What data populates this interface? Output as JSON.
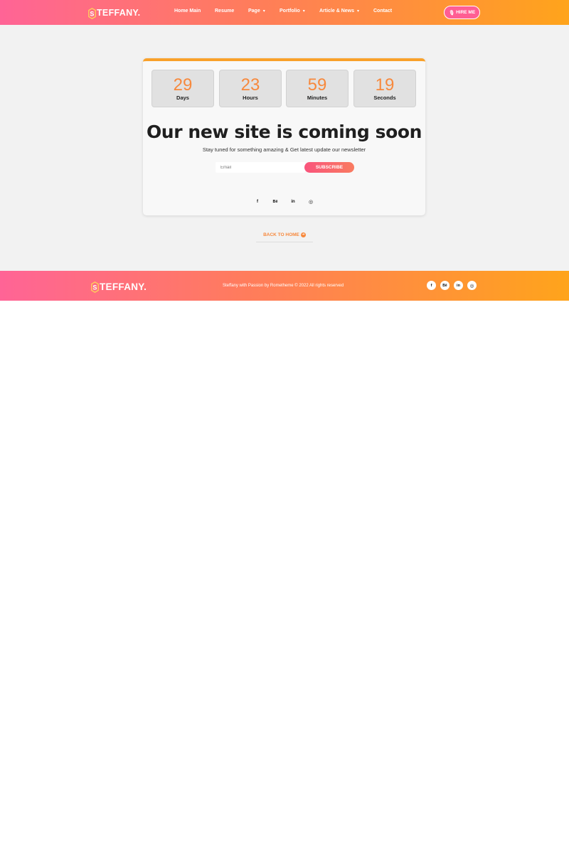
{
  "header": {
    "logo_text": "TEFFANY.",
    "nav": [
      {
        "label": "Home Main",
        "dropdown": false
      },
      {
        "label": "Resume",
        "dropdown": false
      },
      {
        "label": "Page",
        "dropdown": true
      },
      {
        "label": "Portfolio",
        "dropdown": true
      },
      {
        "label": "Article & News",
        "dropdown": true
      },
      {
        "label": "Contact",
        "dropdown": false
      }
    ],
    "hire_label": "HIRE ME"
  },
  "countdown": [
    {
      "value": "29",
      "unit": "Days"
    },
    {
      "value": "23",
      "unit": "Hours"
    },
    {
      "value": "59",
      "unit": "Minutes"
    },
    {
      "value": "19",
      "unit": "Seconds"
    }
  ],
  "hero": {
    "headline": "Our new site is coming soon",
    "subline": "Stay tuned for something amazing & Get latest update our newsletter",
    "email_placeholder": "Email",
    "subscribe_label": "SUBSCRIBE"
  },
  "social": [
    {
      "icon": "facebook-icon",
      "glyph": "f"
    },
    {
      "icon": "behance-icon",
      "glyph": "Bē"
    },
    {
      "icon": "linkedin-icon",
      "glyph": "in"
    },
    {
      "icon": "instagram-icon",
      "glyph": "◎"
    }
  ],
  "back_home_label": "BACK TO HOME",
  "footer": {
    "logo_text": "TEFFANY.",
    "copyright": "Steffany with Passion by Rometheme © 2022 All rights reserved"
  },
  "colors": {
    "gradient_start": "#ff6496",
    "gradient_end": "#ffa41b",
    "accent_orange": "#f7893d",
    "card_top_border": "#f9a12a"
  }
}
